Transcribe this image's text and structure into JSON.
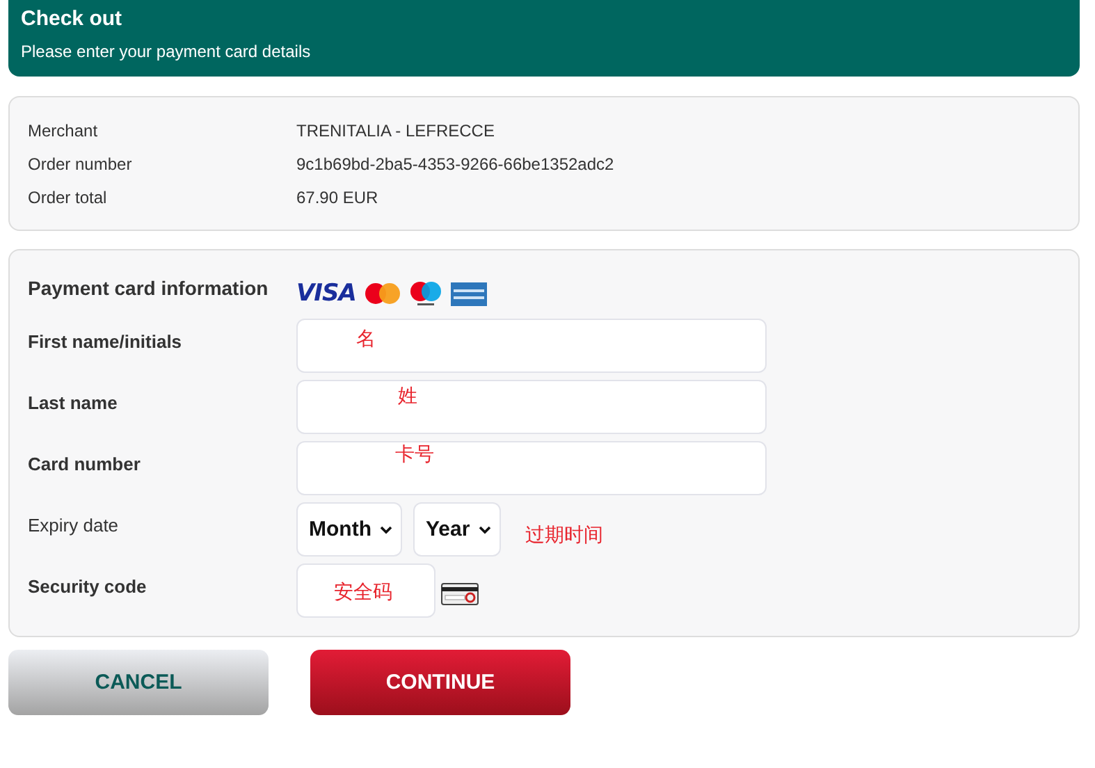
{
  "header": {
    "title": "Check out",
    "subtitle": "Please enter your payment card details"
  },
  "order": [
    {
      "label": "Merchant",
      "value": "TRENITALIA - LEFRECCE"
    },
    {
      "label": "Order number",
      "value": "9c1b69bd-2ba5-4353-9266-66be1352adc2"
    },
    {
      "label": "Order total",
      "value": "67.90 EUR"
    }
  ],
  "payment": {
    "title": "Payment card information",
    "logos": [
      {
        "kind": "visa",
        "label": "VISA"
      },
      {
        "kind": "mastercard"
      },
      {
        "kind": "maestro"
      },
      {
        "kind": "amex"
      }
    ],
    "fields": [
      {
        "kind": "text",
        "label": "First name/initials",
        "bold": true,
        "annotation": "名"
      },
      {
        "kind": "text",
        "label": "Last name",
        "bold": true,
        "annotation": "姓"
      },
      {
        "kind": "text",
        "label": "Card number",
        "bold": true,
        "annotation": "卡号"
      },
      {
        "kind": "expiry",
        "label": "Expiry date",
        "bold": false,
        "selects": [
          "Month",
          "Year"
        ],
        "annotation": "过期时间"
      },
      {
        "kind": "cvc",
        "label": "Security code",
        "bold": true,
        "annotation": "安全码"
      }
    ]
  },
  "buttons": [
    {
      "kind": "cancel",
      "label": "CANCEL"
    },
    {
      "kind": "continue",
      "label": "CONTINUE"
    }
  ]
}
